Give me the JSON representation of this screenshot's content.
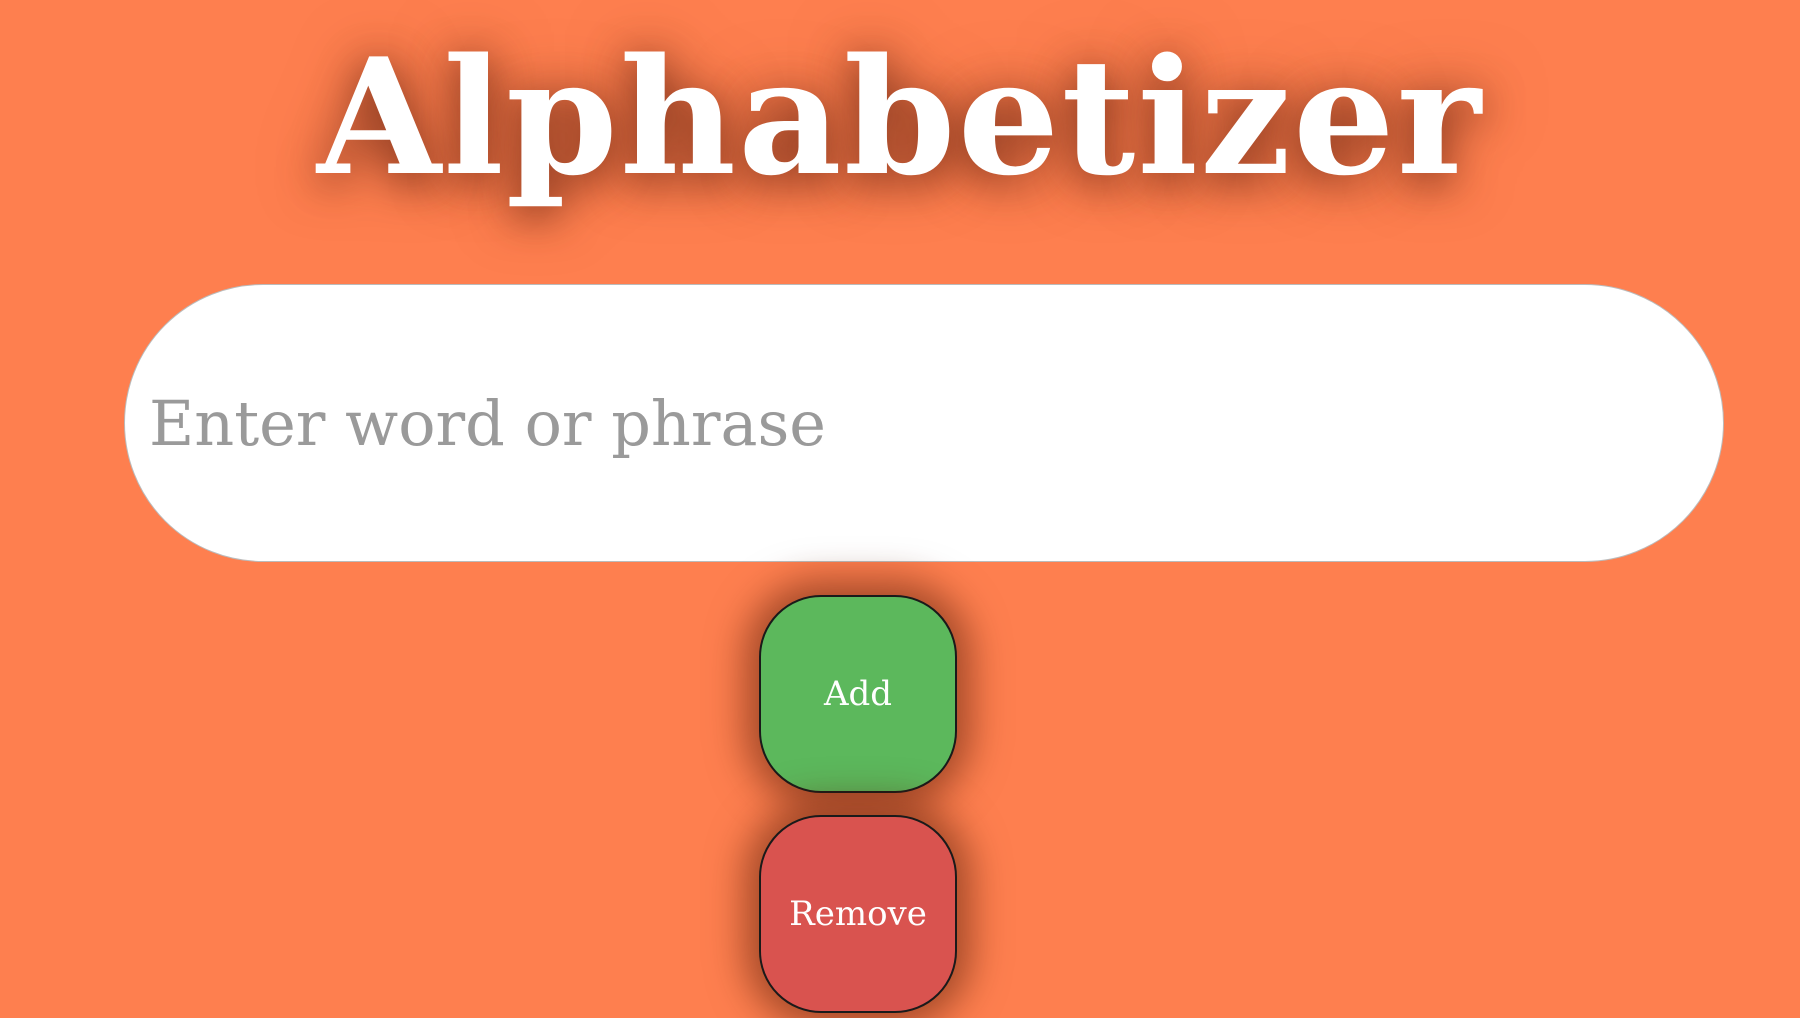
{
  "app": {
    "title": "Alphabetizer"
  },
  "input": {
    "placeholder": "Enter word or phrase",
    "value": ""
  },
  "buttons": {
    "add_label": "Add",
    "remove_label": "Remove"
  },
  "colors": {
    "background": "#fe7f4f",
    "add_button": "#5cb85c",
    "remove_button": "#d9534f",
    "title_text": "#ffffff"
  }
}
